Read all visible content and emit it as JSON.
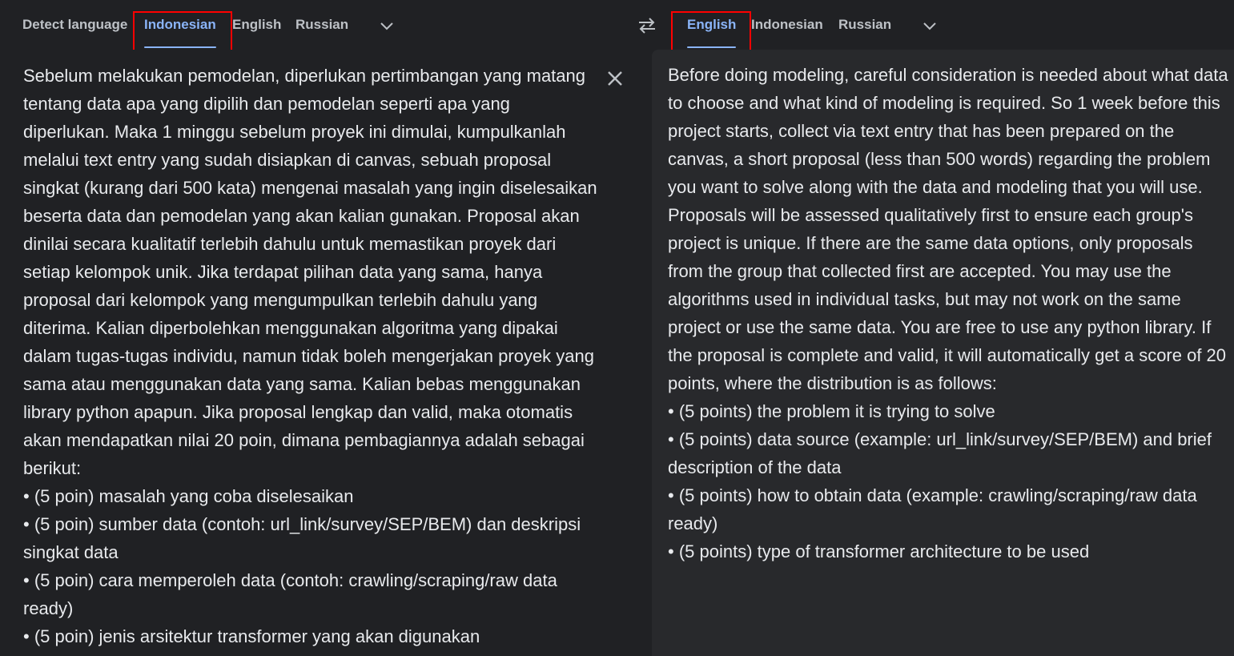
{
  "source": {
    "tabs": [
      {
        "label": "Detect language",
        "active": false
      },
      {
        "label": "Indonesian",
        "active": true
      },
      {
        "label": "English",
        "active": false
      },
      {
        "label": "Russian",
        "active": false
      }
    ],
    "text": "Sebelum melakukan pemodelan, diperlukan pertimbangan yang matang tentang data apa yang dipilih dan pemodelan seperti apa yang diperlukan. Maka 1 minggu sebelum proyek ini dimulai, kumpulkanlah melalui text entry yang sudah disiapkan di canvas, sebuah proposal singkat (kurang dari 500 kata) mengenai masalah yang ingin diselesaikan beserta data dan pemodelan yang akan kalian gunakan. Proposal akan dinilai secara kualitatif terlebih dahulu untuk memastikan proyek dari setiap kelompok unik. Jika terdapat pilihan data yang sama, hanya proposal dari kelompok yang mengumpulkan terlebih dahulu yang diterima. Kalian diperbolehkan menggunakan algoritma yang dipakai dalam tugas-tugas individu, namun tidak  boleh mengerjakan proyek yang sama atau menggunakan data yang sama. Kalian bebas menggunakan library python apapun. Jika proposal lengkap dan valid, maka otomatis akan mendapatkan nilai 20 poin, dimana pembagiannya adalah sebagai berikut:\n• (5 poin) masalah yang coba diselesaikan\n• (5 poin) sumber data (contoh: url_link/survey/SEP/BEM) dan deskripsi singkat data\n• (5 poin) cara memperoleh data (contoh: crawling/scraping/raw data ready)\n• (5 poin) jenis arsitektur transformer yang akan digunakan"
  },
  "target": {
    "tabs": [
      {
        "label": "English",
        "active": true
      },
      {
        "label": "Indonesian",
        "active": false
      },
      {
        "label": "Russian",
        "active": false
      }
    ],
    "text": "Before doing modeling, careful consideration is needed about what data to choose and what kind of modeling is required. So 1 week before this project starts, collect via text entry that has been prepared on the canvas, a short proposal (less than 500 words) regarding the problem you want to solve along with the data and modeling that you will use. Proposals will be assessed qualitatively first to ensure each group's project is unique. If there are the same data options, only proposals from the group that collected first are accepted. You may use the algorithms used in individual tasks, but may not work on the same project or use the same data. You are free to use any python library. If the proposal is complete and valid, it will automatically get a score of 20 points, where the distribution is as follows:\n• (5 points) the problem it is trying to solve\n• (5 points) data source (example: url_link/survey/SEP/BEM) and brief description of the data\n• (5 points) how to obtain data (example: crawling/scraping/raw data ready)\n• (5 points) type of transformer architecture to be used"
  },
  "icons": {
    "swap": "swap-languages-icon",
    "dropdown": "chevron-down-icon",
    "clear": "close-icon"
  },
  "colors": {
    "background": "#202124",
    "target_panel": "#28292c",
    "text": "#e8eaed",
    "tab_text": "#bdc1c6",
    "active_tab": "#8ab4f8",
    "highlight": "#ff0000"
  }
}
